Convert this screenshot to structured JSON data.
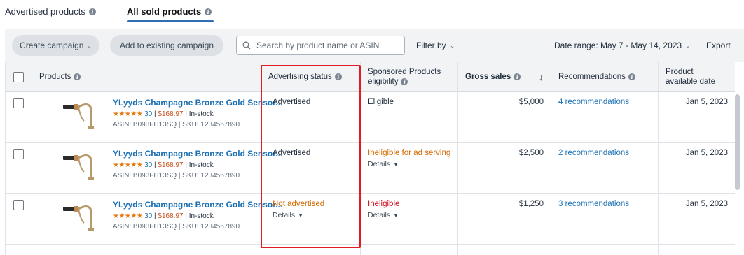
{
  "tabs": [
    {
      "label": "Advertised products",
      "active": false
    },
    {
      "label": "All sold products",
      "active": true
    }
  ],
  "toolbar": {
    "create_campaign": "Create campaign",
    "add_existing": "Add to existing campaign",
    "search_placeholder": "Search by product name or ASIN",
    "filter_by": "Filter by",
    "date_range": "Date range: May 7 - May 14, 2023",
    "export": "Export"
  },
  "table": {
    "headers": {
      "products": "Products",
      "advertising_status": "Advertising status",
      "sp_eligibility_line1": "Sponsored Products",
      "sp_eligibility_line2": "eligibility",
      "gross_sales": "Gross sales",
      "sort_icon": "arrow-down-icon",
      "recommendations": "Recommendations",
      "available_line1": "Product",
      "available_line2": "available date"
    },
    "rows": [
      {
        "title": "YLyyds Champagne Bronze Gold Sensor...",
        "stars": "★★★★★",
        "reviews": "30",
        "price": "$168.97",
        "stock": "In-stock",
        "asin_sku": "ASIN: B093FH13SQ | SKU: 1234567890",
        "ad_status": "Advertised",
        "ad_status_details": "",
        "eligibility": "Eligible",
        "eligibility_details": "",
        "gross_sales": "$5,000",
        "recommendations": "4 recommendations",
        "available_date": "Jan 5, 2023"
      },
      {
        "title": "YLyyds Champagne Bronze Gold Sensor...",
        "stars": "★★★★★",
        "reviews": "30",
        "price": "$168.97",
        "stock": "In-stock",
        "asin_sku": "ASIN: B093FH13SQ | SKU: 1234567890",
        "ad_status": "Advertised",
        "ad_status_details": "",
        "eligibility": "Ineligible for ad serving",
        "eligibility_details": "Details",
        "gross_sales": "$2,500",
        "recommendations": "2 recommendations",
        "available_date": "Jan 5, 2023"
      },
      {
        "title": "YLyyds Champagne Bronze Gold Sensor...",
        "stars": "★★★★★",
        "reviews": "30",
        "price": "$168.97",
        "stock": "In-stock",
        "asin_sku": "ASIN: B093FH13SQ | SKU: 1234567890",
        "ad_status": "Not advertised",
        "ad_status_details": "Details",
        "eligibility": "Ineligible",
        "eligibility_details": "Details",
        "gross_sales": "$1,250",
        "recommendations": "3 recommendations",
        "available_date": "Jan 5, 2023"
      }
    ]
  },
  "colors": {
    "link": "#1a6fb4",
    "warning": "#d46a00",
    "error": "#cc0c1e",
    "highlight_box": "#e01b24",
    "star": "#e47911"
  }
}
